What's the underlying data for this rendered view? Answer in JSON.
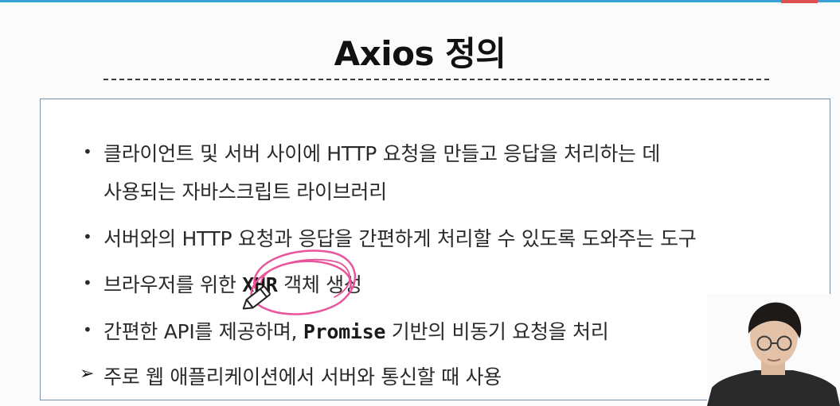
{
  "slide": {
    "title": "Axios 정의",
    "bullets": [
      {
        "marker": "•",
        "line1": "클라이언트 및 서버 사이에 HTTP 요청을 만들고 응답을 처리하는 데",
        "line2": "사용되는 자바스크립트 라이브러리"
      },
      {
        "marker": "•",
        "text": "서버와의 HTTP 요청과 응답을 간편하게 처리할 수 있도록 도와주는 도구"
      },
      {
        "marker": "•",
        "pre": "브라우저를 위한 ",
        "code": "XHR",
        "post": " 객체 생성"
      },
      {
        "marker": "•",
        "pre": "간편한 API를 제공하며, ",
        "code": "Promise",
        "post": " 기반의 비동기 요청을 처리"
      }
    ],
    "summary": {
      "marker": "➢",
      "text": "주로 웹 애플리케이션에서 서버와 통신할 때 사용"
    }
  },
  "colors": {
    "annotation": "#e8559a",
    "box_border": "#7a8fa8",
    "top_bar": "#3aa0d8"
  },
  "icons": {
    "pointer": "pen-cursor-icon"
  }
}
